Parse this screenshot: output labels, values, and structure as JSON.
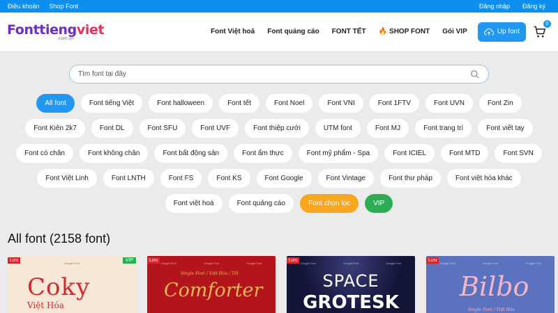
{
  "topbar": {
    "left": [
      "Điều khoản",
      "Shop Font"
    ],
    "right": [
      "Đăng nhập",
      "Đăng ký"
    ]
  },
  "logo": {
    "part1": "Fonttieng",
    "part2": "viet",
    "sub": ".com.vn"
  },
  "nav": {
    "items": [
      "Font Việt hoá",
      "Font quảng cáo",
      "FONT TẾT",
      "SHOP FONT",
      "Gói VIP"
    ],
    "upload_label": "Up font",
    "cart_count": "0"
  },
  "search": {
    "placeholder": "Tìm font tại đây"
  },
  "tags": [
    [
      "All font",
      "Font tiếng Việt",
      "Font halloween",
      "Font tết",
      "Font Noel",
      "Font VNI",
      "Font 1FTV",
      "Font UVN",
      "Font Zin"
    ],
    [
      "Font Kiên 2k7",
      "Font DL",
      "Font SFU",
      "Font UVF",
      "Font thiệp cưới",
      "UTM font",
      "Font MJ",
      "Font trang trí",
      "Font viết tay"
    ],
    [
      "Font có chân",
      "Font không chân",
      "Font bất động sản",
      "Font ẩm thực",
      "Font mỹ phẩm - Spa",
      "Font ICIEL",
      "Font MTD",
      "Font SVN"
    ],
    [
      "Font Việt Linh",
      "Font LNTH",
      "Font FS",
      "Font KS",
      "Font Google",
      "Font Vintage",
      "Font thư pháp",
      "Font việt hóa khác"
    ],
    [
      "Font việt hoá",
      "Font quảng cáo",
      "Font chọn lọc",
      "VIP"
    ]
  ],
  "section_title": "All font (2158 font)",
  "cards": [
    {
      "luu": "Lưu",
      "vip": "VIP",
      "big": "Coky",
      "small": "Việt Hóa",
      "row": [
        "",
        "Google Font",
        ""
      ]
    },
    {
      "luu": "Lưu",
      "big": "Comforter",
      "small": "Single Font / Việt Hóa / Tết",
      "row": [
        "Google Font",
        "Google Font",
        "Google Font"
      ]
    },
    {
      "luu": "Lưu",
      "big1": "SPACE",
      "big2": "GROTESK",
      "row": [
        "Google Font",
        "Google Font",
        "Google Font"
      ]
    },
    {
      "luu": "Lưu",
      "big": "Bilbo",
      "small": "Single Font / Việt Hóa",
      "row": [
        "Google Font",
        "Google Font",
        "Google Font"
      ]
    }
  ],
  "colors": {
    "primary": "#1f97f3",
    "orange": "#f7a61e",
    "green": "#2dad53",
    "red": "#d8262e"
  }
}
